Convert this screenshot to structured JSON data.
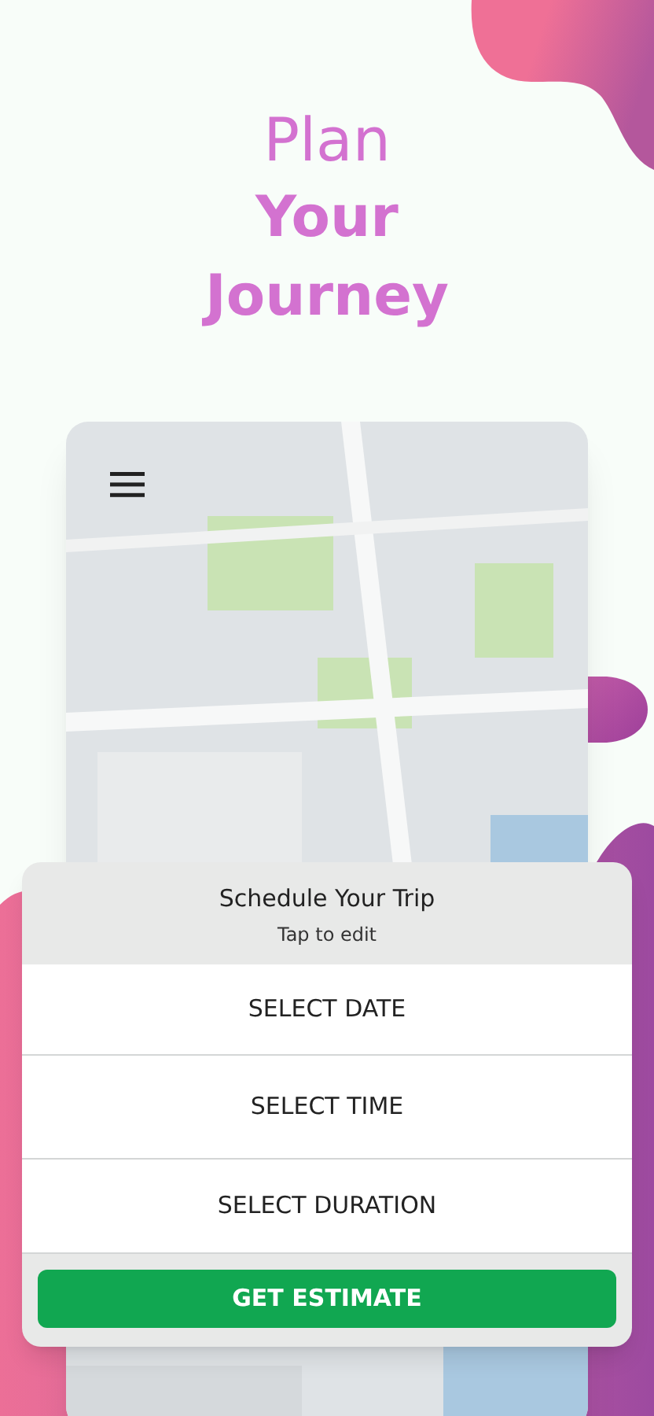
{
  "headline": [
    {
      "text": "Plan",
      "bold": false
    },
    {
      "text": "Your",
      "bold": true
    },
    {
      "text": "Journey",
      "bold": true
    }
  ],
  "schedule": {
    "title": "Schedule Your Trip",
    "subtitle": "Tap to edit",
    "options": [
      "SELECT DATE",
      "SELECT TIME",
      "SELECT DURATION"
    ],
    "button": "GET ESTIMATE"
  }
}
